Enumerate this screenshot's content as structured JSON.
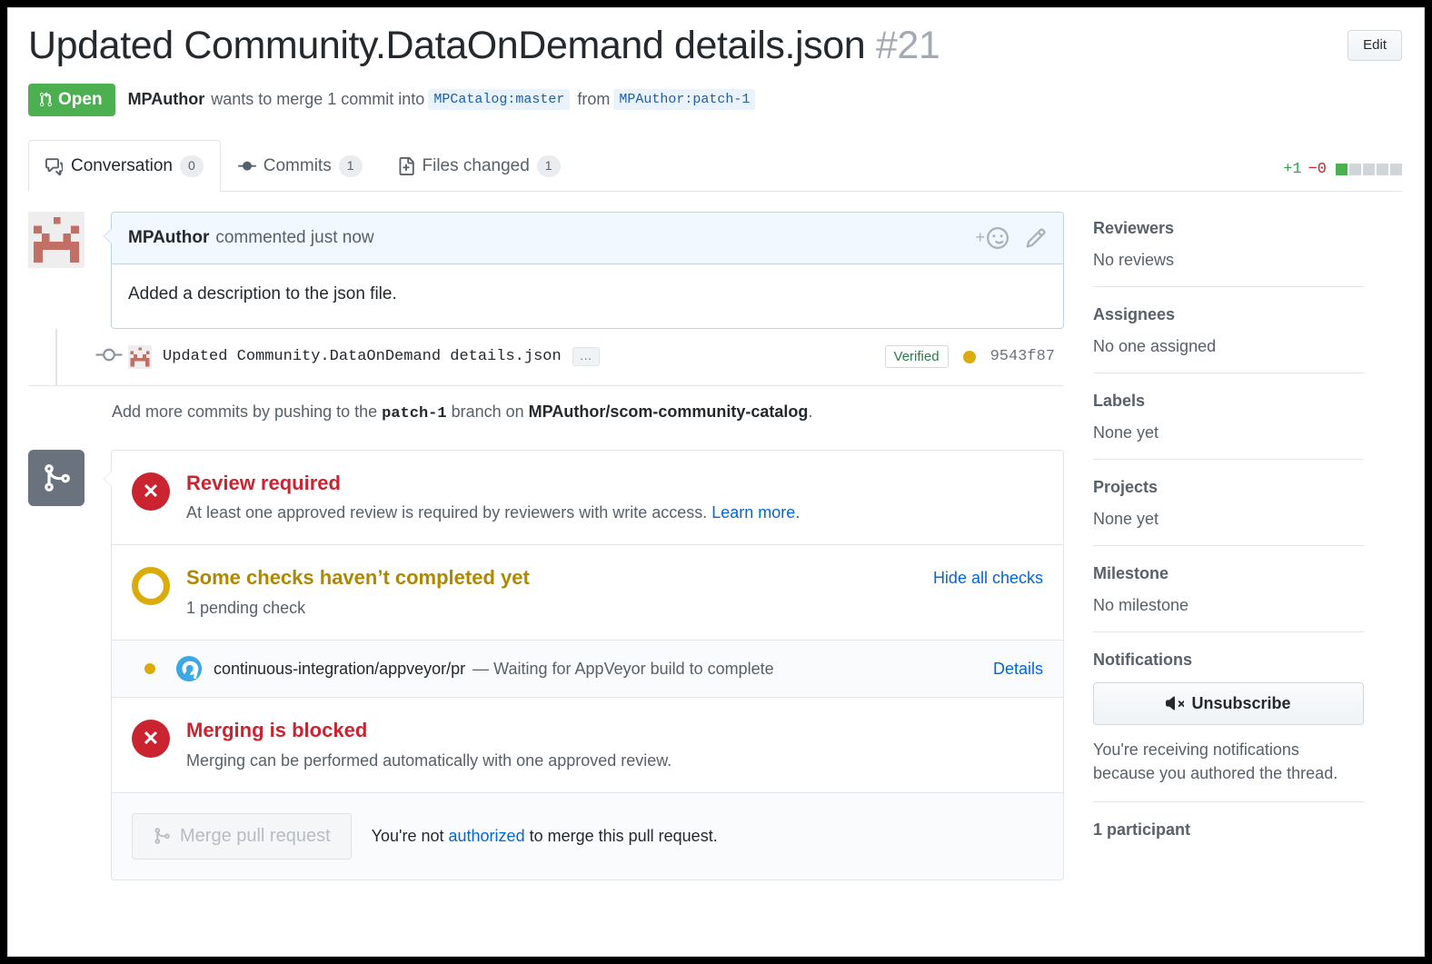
{
  "header": {
    "title": "Updated Community.DataOnDemand details.json",
    "number": "#21",
    "edit_label": "Edit",
    "state": "Open",
    "state_color": "#4caf50",
    "byline_author": "MPAuthor",
    "byline_text_1": "wants to merge 1 commit into",
    "base_branch": "MPCatalog:master",
    "byline_text_2": "from",
    "head_branch": "MPAuthor:patch-1"
  },
  "tabs": [
    {
      "label": "Conversation",
      "count": "0",
      "icon": "comment-discussion-icon",
      "active": true
    },
    {
      "label": "Commits",
      "count": "1",
      "icon": "git-commit-icon",
      "active": false
    },
    {
      "label": "Files changed",
      "count": "1",
      "icon": "diff-file-icon",
      "active": false
    }
  ],
  "diffstat": {
    "additions": "+1",
    "deletions": "−0",
    "blocks_total": 5,
    "blocks_added": 1,
    "added_color": "#28a745",
    "deleted_color": "#cb2431"
  },
  "comment": {
    "author": "MPAuthor",
    "meta": "commented just now",
    "body": "Added a description to the json file.",
    "reaction_icon": "add-reaction-icon",
    "edit_icon": "pencil-icon"
  },
  "commit": {
    "message": "Updated Community.DataOnDemand details.json",
    "more_label": "…",
    "verified_label": "Verified",
    "status_color": "#dbab09",
    "sha": "9543f87"
  },
  "push_note": {
    "prefix": "Add more commits by pushing to the",
    "branch": "patch-1",
    "middle": "branch on",
    "repo": "MPAuthor/scom-community-catalog",
    "suffix": "."
  },
  "merge_box": {
    "icon": "git-merge-icon",
    "review_required": {
      "icon": "x-circle-icon",
      "title": "Review required",
      "desc": "At least one approved review is required by reviewers with write access.",
      "link": "Learn more."
    },
    "checks": {
      "icon": "pending-ring-icon",
      "title": "Some checks haven’t completed yet",
      "desc": "1 pending check",
      "toggle_label": "Hide all checks"
    },
    "check_items": [
      {
        "status_color": "#dbab09",
        "avatar_icon": "appveyor-icon",
        "name": "continuous-integration/appveyor/pr",
        "desc": "— Waiting for AppVeyor build to complete",
        "details_label": "Details"
      }
    ],
    "blocked": {
      "icon": "x-circle-icon",
      "title": "Merging is blocked",
      "desc": "Merging can be performed automatically with one approved review."
    },
    "footer": {
      "merge_button": "Merge pull request",
      "merge_button_icon": "git-merge-icon",
      "note_prefix": "You're not",
      "note_link": "authorized",
      "note_suffix": "to merge this pull request."
    }
  },
  "sidebar": {
    "sections": [
      {
        "title": "Reviewers",
        "value": "No reviews"
      },
      {
        "title": "Assignees",
        "value": "No one assigned"
      },
      {
        "title": "Labels",
        "value": "None yet"
      },
      {
        "title": "Projects",
        "value": "None yet"
      },
      {
        "title": "Milestone",
        "value": "No milestone"
      }
    ],
    "notifications": {
      "title": "Notifications",
      "button_label": "Unsubscribe",
      "button_icon": "mute-icon",
      "note": "You're receiving notifications because you authored the thread."
    },
    "participants": "1 participant"
  }
}
